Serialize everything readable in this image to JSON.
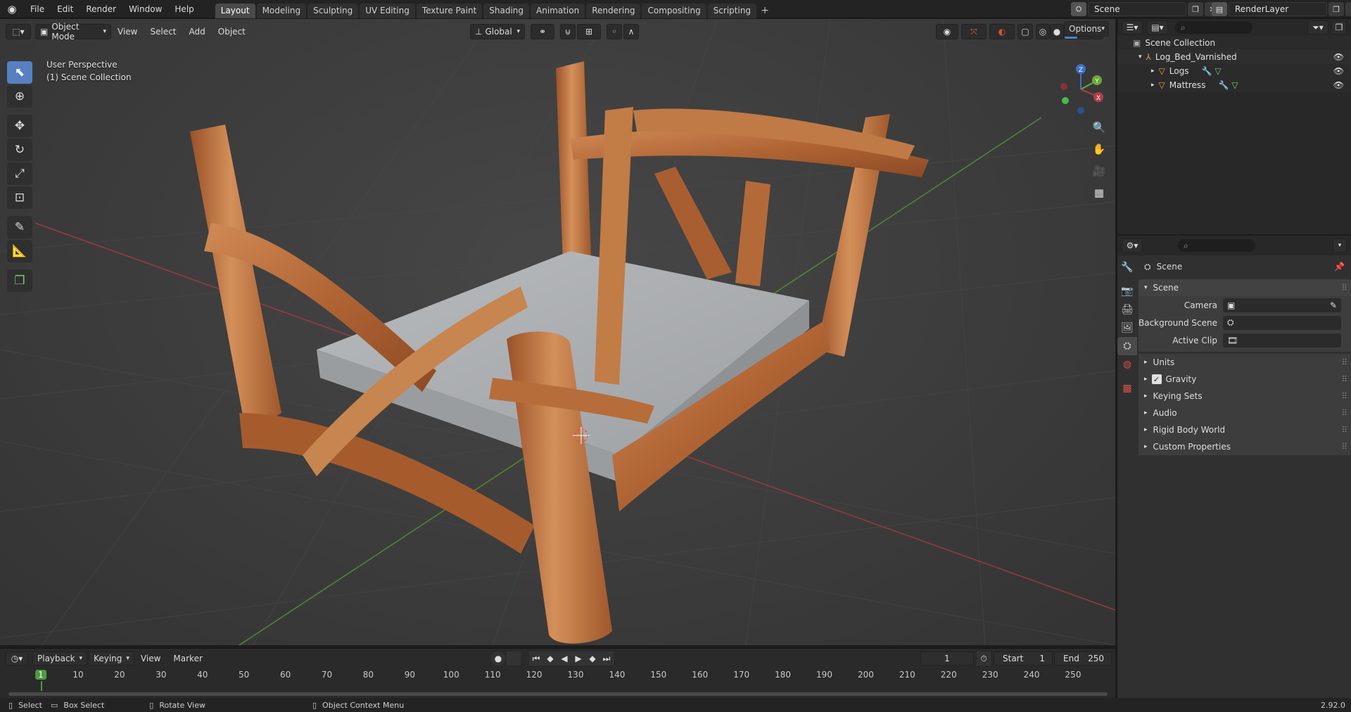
{
  "topbar": {
    "menus": [
      "File",
      "Edit",
      "Render",
      "Window",
      "Help"
    ],
    "workspaces": [
      "Layout",
      "Modeling",
      "Sculpting",
      "UV Editing",
      "Texture Paint",
      "Shading",
      "Animation",
      "Rendering",
      "Compositing",
      "Scripting"
    ],
    "active_workspace": "Layout",
    "scene_name": "Scene",
    "view_layer_name": "RenderLayer"
  },
  "viewport": {
    "mode_label": "Object Mode",
    "menus": [
      "View",
      "Select",
      "Add",
      "Object"
    ],
    "transform_orientation": "Global",
    "options_label": "Options",
    "overlay_line1": "User Perspective",
    "overlay_line2": "(1) Scene Collection",
    "gizmo": {
      "z": "Z",
      "y": "Y",
      "x": "X"
    }
  },
  "outliner": {
    "root": "Scene Collection",
    "collection": "Log_Bed_Varnished",
    "children": [
      "Logs",
      "Mattress"
    ]
  },
  "properties": {
    "context_title": "Scene",
    "panel_title": "Scene",
    "camera_label": "Camera",
    "background_scene_label": "Background Scene",
    "active_clip_label": "Active Clip",
    "subpanels": [
      "Units",
      "Gravity",
      "Keying Sets",
      "Audio",
      "Rigid Body World",
      "Custom Properties"
    ],
    "gravity_checked": true
  },
  "timeline": {
    "menus": [
      "Playback",
      "Keying",
      "View",
      "Marker"
    ],
    "current_frame": "1",
    "start_label": "Start",
    "start_value": "1",
    "end_label": "End",
    "end_value": "250",
    "ticks": [
      "1",
      "10",
      "20",
      "30",
      "40",
      "50",
      "60",
      "70",
      "80",
      "90",
      "100",
      "110",
      "120",
      "130",
      "140",
      "150",
      "160",
      "170",
      "180",
      "190",
      "200",
      "210",
      "220",
      "230",
      "240",
      "250"
    ]
  },
  "statusbar": {
    "select": "Select",
    "box_select": "Box Select",
    "rotate_view": "Rotate View",
    "context_menu": "Object Context Menu",
    "version": "2.92.0"
  },
  "colors": {
    "accent": "#5680c2",
    "axis_x": "#b53f48",
    "axis_y": "#6aa838",
    "axis_z": "#3e6fc7",
    "wood": "#b8693a",
    "mattress": "#a9acae"
  }
}
